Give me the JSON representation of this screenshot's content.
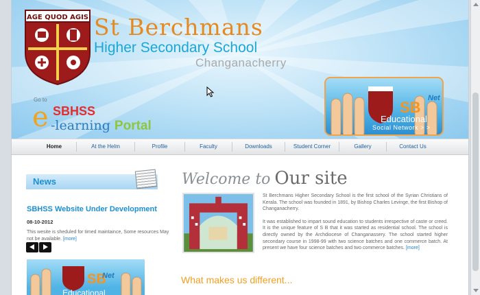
{
  "header": {
    "crest_motto": "AGE QUOD AGIS",
    "school_name": "St Berchmans",
    "school_sub": "Higher Secondary School",
    "school_place": "Changanacherry",
    "goto_label": "Go to",
    "portal": {
      "e": "e",
      "sbhss": "SBHSS",
      "learning": "-learning",
      "portal": "Portal"
    },
    "social_banner": {
      "sb": "SB",
      "net": "Net",
      "educational": "Educational",
      "social_network": "Social Network > >"
    }
  },
  "nav": {
    "items": [
      {
        "label": "Home",
        "active": true
      },
      {
        "label": "At the Helm"
      },
      {
        "label": "Profile"
      },
      {
        "label": "Faculty"
      },
      {
        "label": "Downloads"
      },
      {
        "label": "Student Corner"
      },
      {
        "label": "Gallery"
      },
      {
        "label": "Contact Us"
      }
    ]
  },
  "news": {
    "heading": "News",
    "title": "SBHSS Website Under Development",
    "date": "08-10-2012",
    "body": "This wesite is sheduled for timed maintaince, Some resources May not be available.",
    "more": "[more]"
  },
  "mini_banner": {
    "sb": "SB",
    "net": "Net",
    "educational": "Educational"
  },
  "welcome": {
    "script": "Welcome to",
    "title": "Our site",
    "para1": "St Berchmans Higher Secondary School is the first school of the Syrian Christians of Kerala. The school was founded in 1891, by Bishop Charles Levinge, the first Bishop of Changanacherry.",
    "para2": "It was established to impart sound education to students irrespective of caste or creed. It is the unique feature of S B that it was started as residential school. The school is directly owned by the Archdiocese of Changanassery. The school started higher secondary course in 1998-99 with two science batches and one commerce batch. At present we have four science batches and two commerce batches.",
    "more": "[more]",
    "subheading": "What makes us different..."
  },
  "colors": {
    "orange": "#e58a22",
    "blue": "#1aa7d8",
    "nav_link": "#1f5f9c",
    "crest_red": "#9e1b1b"
  },
  "icons": {
    "prev": "left-arrow-icon",
    "next": "right-arrow-icon",
    "cursor": "mouse-pointer-icon"
  }
}
